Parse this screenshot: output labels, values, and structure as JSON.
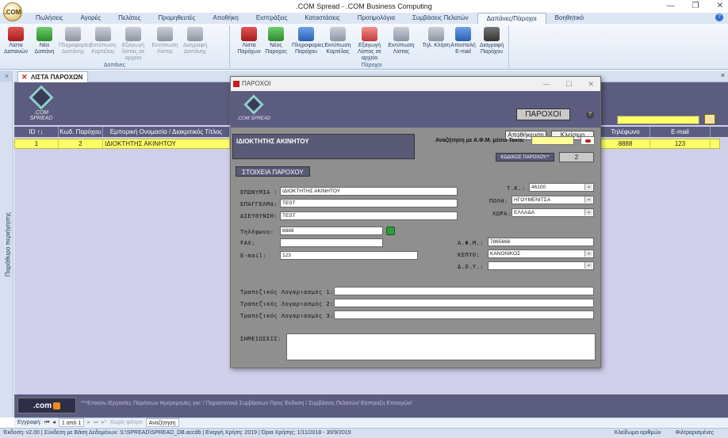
{
  "app": {
    "title": ".COM Spread - .COM Business Computing",
    "orb_label": ".COM"
  },
  "menu": {
    "tabs": [
      "Πωλήσεις",
      "Αγορές",
      "Πελάτες",
      "Προμηθευτές",
      "Αποθήκη",
      "Εισπράξεις",
      "Καταστάσεις",
      "Προτιμολόγια",
      "Συμβάσεις Πελατών",
      "Δαπάνες/Πάροχοι",
      "Βοηθητικό"
    ],
    "active": "Δαπάνες/Πάροχοι"
  },
  "ribbon": {
    "group1": {
      "label": "Δαπάνες",
      "buttons": [
        "Λίστα Δαπανών",
        "Νέα Δαπάνη",
        "Πληροφορίες Δαπάνης",
        "Εκτύπωση Καρτέλας",
        "Εξαγωγή λίστας σε αρχείο",
        "Εκτύπωση Λίστας",
        "Διαγραφή Δαπάνης"
      ]
    },
    "group2": {
      "label": "Πάροχοι",
      "buttons": [
        "Λίστα Παρόχων",
        "Νέος Παροχος",
        "Πληροφορίες Παρόχου",
        "Εκτύπωση Καρτέλας",
        "Εξαγωγή Λίστας σε αρχείο",
        "Εκτύπωση Λίστας",
        "Τηλ. Κλήση",
        "Αποστολή E-mail",
        "Διαγραφή Παρόχου"
      ]
    }
  },
  "sidebar": {
    "collapse": "»",
    "label": "Παράθυρο περιήγησης"
  },
  "doc_tab": {
    "label": "ΛΙΣΤΑ ΠΑΡΟΧΩΝ",
    "close": "×"
  },
  "grid": {
    "columns": [
      "ID ↑↓",
      "Κωδ. Παρόχου",
      "Εμπορική Ονομασία / Διακριτικός Τίτλος",
      "Τηλέφωνο",
      "E-mail"
    ],
    "rows": [
      {
        "id": "1",
        "code": "2",
        "name": "ΙΔΙΟΚΤΗΤΗΣ ΑΚΙΝΗΤΟΥ",
        "phone": "8888",
        "email": "123"
      }
    ]
  },
  "footer": {
    "logo": ".com",
    "text": "***Επικοιν./Εργασίες Παρ/σεων Ημερομηνίες για: / Παραστατικά Συμβάσεων Προς Έκδοση / Συμβάσεις Πελατών/ Είσπραξη Επιταγών/"
  },
  "navbar": {
    "record_label": "Εγγραφή:",
    "first": "⏮",
    "prev": "◂",
    "page": "1 από 1",
    "next": "▸",
    "last": "⏭",
    "new": "▸*",
    "filter": "Χωρίς φίλτρο",
    "search": "Αναζήτηση"
  },
  "status": {
    "left": "Έκδοση: v2.00  |  Σύνδεση με Βάση Δεδομένων: S:\\SPREAD\\SPREAD_DB.accdb  |  Ενεργή Χρήση: 2019  |  Όρια Χρήσης: 1/11/2018 - 30/9/2019",
    "numlock": "Κλείδωμα αριθμών",
    "filtered": "Φιλτραρισμένες"
  },
  "dialog": {
    "title": "ΠΑΡΟΧΟΙ",
    "header_title": "ΠΑΡΟΧΟΙ",
    "help": "?",
    "save_button": "Αποθήκευση",
    "close_button": "Κλείσιμο",
    "logo": ".COM SPREAD",
    "name_display": "ΙΔΙΟΚΤΗΤΗΣ ΑΚΙΝΗΤΟΥ",
    "afm_search_label": "Αναζήτηση με Α.Φ.Μ. μέσω Taxis:",
    "afm_search_value": "",
    "code_label": "ΚΩΔΙΚΟΣ ΠΑΡΟΧΟΥ:*",
    "code_value": "2",
    "section_label": "ΣΤΟΙΧΕΙΑ ΠΑΡΟΧΟΥ",
    "fields": {
      "name_label": "ΕΠΩΝΥΜΙΑ :",
      "name_value": "ΙΔΙΟΚΤΗΤΗΣ ΑΚΙΝΗΤΟΥ",
      "profession_label": "ΕΠΑΓΓΕΛΜΑ:",
      "profession_value": "TEST",
      "address_label": "ΔΙΕΥΘΥΝΣΗ:",
      "address_value": "TEST",
      "phone_label": "Τηλέφωνο:",
      "phone_value": "8888",
      "fax_label": "FAX:",
      "fax_value": "",
      "email_label": "E-mail:",
      "email_value": "123",
      "tk_label": "Τ.Κ.:",
      "tk_value": "46100",
      "city_label": "ΠΟΛΗ:",
      "city_value": "ΗΓΟΥΜΕΝΙΤΣΑ",
      "country_label": "ΧΩΡΑ:",
      "country_value": "ΕΛΛΑΔΑ",
      "afm_label": "Α.Φ.Μ.:",
      "afm_value": "7865666",
      "kepyo_label": "ΚΕΠΥΟ:",
      "kepyo_value": "ΚΑΝΟΝΙΚΟΣ",
      "doy_label": "Δ.Ο.Υ.:",
      "doy_value": "",
      "bank1_label": "Τραπεζικός Λογαριασμός 1:",
      "bank1_value": "",
      "bank2_label": "Τραπεζικός Λογαριασμός 2:",
      "bank2_value": "",
      "bank3_label": "Τραπεζικός Λογαριασμός 3:",
      "bank3_value": "",
      "notes_label": "ΣΗΜΕΙΩΣΕΙΣ:",
      "notes_value": ""
    }
  }
}
